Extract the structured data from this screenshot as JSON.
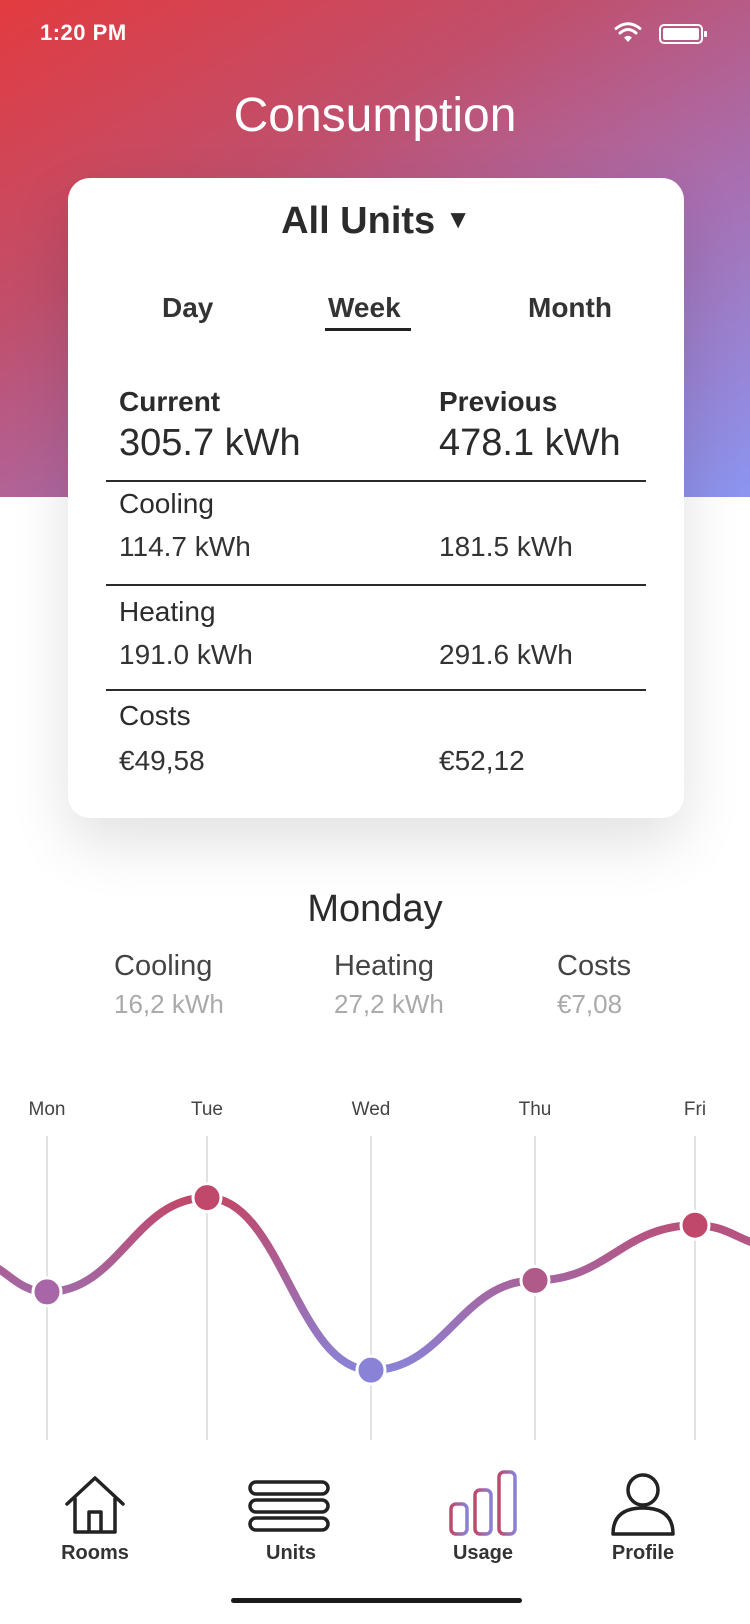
{
  "status": {
    "time": "1:20 PM"
  },
  "header": {
    "title": "Consumption"
  },
  "card": {
    "unit_selector": "All Units",
    "tabs": [
      "Day",
      "Week",
      "Month"
    ],
    "selected_tab": "Week",
    "current": {
      "label": "Current",
      "value": "305.7 kWh"
    },
    "previous": {
      "label": "Previous",
      "value": "478.1 kWh"
    },
    "rows": [
      {
        "label": "Cooling",
        "current": "114.7 kWh",
        "previous": "181.5 kWh"
      },
      {
        "label": "Heating",
        "current": "191.0 kWh",
        "previous": "291.6 kWh"
      },
      {
        "label": "Costs",
        "current": "€49,58",
        "previous": "€52,12"
      }
    ]
  },
  "day_detail": {
    "title": "Monday",
    "metrics": [
      {
        "label": "Cooling",
        "value": "16,2 kWh"
      },
      {
        "label": "Heating",
        "value": "27,2 kWh"
      },
      {
        "label": "Costs",
        "value": "€7,08"
      }
    ]
  },
  "chart_data": {
    "type": "line",
    "categories": [
      "Mon",
      "Tue",
      "Wed",
      "Thu",
      "Fri"
    ],
    "values": [
      0.47,
      0.88,
      0.13,
      0.52,
      0.76
    ],
    "ylim": [
      0,
      1
    ],
    "grid": "vertical lines per day"
  },
  "tabbar": {
    "items": [
      {
        "label": "Rooms",
        "icon": "house-icon"
      },
      {
        "label": "Units",
        "icon": "units-icon"
      },
      {
        "label": "Usage",
        "icon": "bar-chart-icon"
      },
      {
        "label": "Profile",
        "icon": "user-icon"
      }
    ],
    "active": "Usage"
  },
  "colors": {
    "gradient_start": "#e23b3f",
    "gradient_mid": "#a86fb0",
    "gradient_end": "#8b95f0",
    "line_high": "#c0486a",
    "line_low": "#8a82d6"
  }
}
